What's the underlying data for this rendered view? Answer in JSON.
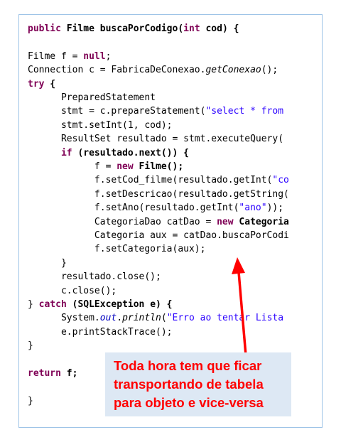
{
  "code": {
    "lines": [
      [
        {
          "t": "public ",
          "s": "kw"
        },
        {
          "t": "Filme buscaPorCodigo(",
          "s": "bold"
        },
        {
          "t": "int",
          "s": "kw"
        },
        {
          "t": " cod) {",
          "s": "bold"
        }
      ],
      [],
      [
        {
          "t": "Filme f = "
        },
        {
          "t": "null",
          "s": "kw"
        },
        {
          "t": ";"
        }
      ],
      [
        {
          "t": "Connection c = FabricaDeConexao."
        },
        {
          "t": "getConexao",
          "s": "it"
        },
        {
          "t": "();"
        }
      ],
      [
        {
          "t": "try",
          "s": "kw"
        },
        {
          "t": " {",
          "s": "bold"
        }
      ],
      [
        {
          "t": "      PreparedStatement"
        }
      ],
      [
        {
          "t": "      stmt = c.prepareStatement("
        },
        {
          "t": "\"select * from",
          "s": "str"
        }
      ],
      [
        {
          "t": "      stmt.setInt(1, cod);"
        }
      ],
      [
        {
          "t": "      ResultSet resultado = stmt.executeQuery("
        }
      ],
      [
        {
          "t": "      "
        },
        {
          "t": "if",
          "s": "kw"
        },
        {
          "t": " (resultado.next()) {",
          "s": "bold"
        }
      ],
      [
        {
          "t": "            f = "
        },
        {
          "t": "new",
          "s": "kw"
        },
        {
          "t": " Filme();",
          "s": "bold"
        }
      ],
      [
        {
          "t": "            f.setCod_filme(resultado.getInt("
        },
        {
          "t": "\"co",
          "s": "str"
        }
      ],
      [
        {
          "t": "            f.setDescricao(resultado.getString("
        }
      ],
      [
        {
          "t": "            f.setAno(resultado.getInt("
        },
        {
          "t": "\"ano\"",
          "s": "str"
        },
        {
          "t": "));"
        }
      ],
      [
        {
          "t": "            CategoriaDao catDao = "
        },
        {
          "t": "new",
          "s": "kw"
        },
        {
          "t": " ",
          "s": ""
        },
        {
          "t": "Categoria",
          "s": "bold"
        }
      ],
      [
        {
          "t": "            Categoria aux = catDao.buscaPorCodi"
        }
      ],
      [
        {
          "t": "            f.setCategoria(aux);"
        }
      ],
      [
        {
          "t": "      }"
        }
      ],
      [
        {
          "t": "      resultado.close();"
        }
      ],
      [
        {
          "t": "      c.close();"
        }
      ],
      [
        {
          "t": "} "
        },
        {
          "t": "catch",
          "s": "kw"
        },
        {
          "t": " (SQLException e) {",
          "s": "bold"
        }
      ],
      [
        {
          "t": "      System."
        },
        {
          "t": "out",
          "s": "field"
        },
        {
          "t": "."
        },
        {
          "t": "println",
          "s": "it"
        },
        {
          "t": "("
        },
        {
          "t": "\"Erro ao tentar Lista",
          "s": "str"
        }
      ],
      [
        {
          "t": "      e.printStackTrace();"
        }
      ],
      [
        {
          "t": "}"
        }
      ],
      [],
      [
        {
          "t": "return",
          "s": "kw"
        },
        {
          "t": " f;",
          "s": "bold"
        }
      ],
      [],
      [
        {
          "t": "}"
        }
      ]
    ]
  },
  "callout": {
    "lines": [
      "Toda hora tem que ficar",
      "transportando de tabela",
      "para objeto e vice-versa"
    ],
    "text_color": "#ff0000",
    "background": "#dde8f4"
  },
  "colors": {
    "keyword": "#7f0055",
    "string": "#2a00ff",
    "border": "#9dc3e6",
    "arrow": "#ff0000"
  }
}
